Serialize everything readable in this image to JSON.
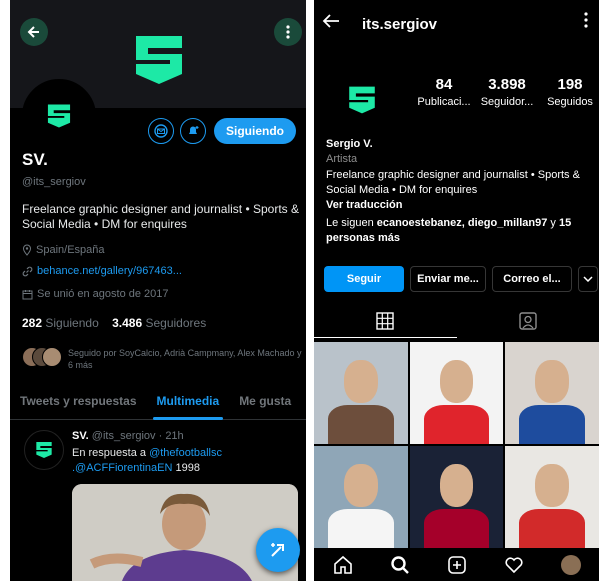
{
  "twitter": {
    "display_name": "SV.",
    "handle": "@its_sergiov",
    "follow_button": "Siguiendo",
    "bio": "Freelance graphic designer and journalist • Sports & Social Media • DM for enquires",
    "location": "Spain/España",
    "link": "behance.net/gallery/967463...",
    "joined": "Se unió en agosto de 2017",
    "following_count": "282",
    "following_label": "Siguiendo",
    "followers_count": "3.486",
    "followers_label": "Seguidores",
    "followed_by": "Seguido por SoyCalcio, Adrià Campmany, Alex Machado y 6 más",
    "tabs": [
      {
        "label": "Tweets y respuestas",
        "active": false
      },
      {
        "label": "Multimedia",
        "active": true
      },
      {
        "label": "Me gusta",
        "active": false
      }
    ],
    "tweet": {
      "name": "SV.",
      "handle_time": "@its_sergiov · 21h",
      "reply_prefix": "En respuesta a ",
      "reply_to_1": "@thefootballsc",
      "reply_to_2": ".@ACFFiorentinaEN",
      "text_suffix": " 1998"
    },
    "icons": {
      "back": "arrow-left-icon",
      "more": "more-vertical-icon",
      "message": "mail-icon",
      "notify": "bell-plus-icon",
      "location": "location-pin-icon",
      "link": "link-icon",
      "calendar": "calendar-icon",
      "compose": "compose-plus-icon"
    },
    "colors": {
      "accent": "#1d9bf0",
      "brand": "#1de9a6"
    }
  },
  "instagram": {
    "username": "its.sergiov",
    "stats": [
      {
        "number": "84",
        "label": "Publicaci..."
      },
      {
        "number": "3.898",
        "label": "Seguidor..."
      },
      {
        "number": "198",
        "label": "Seguidos"
      }
    ],
    "name": "Sergio V.",
    "category": "Artista",
    "bio": "Freelance graphic designer and journalist • Sports & Social Media • DM for enquires",
    "translation": "Ver traducción",
    "followed_prefix": "Le siguen ",
    "followed_names": "ecanoestebanez, diego_millan97",
    "followed_mid": " y ",
    "followed_more": "15 personas más",
    "buttons": {
      "follow": "Seguir",
      "message": "Enviar me...",
      "email": "Correo el...",
      "dropdown": "chevron-down-icon"
    },
    "grid_posts": [
      {
        "name": "post-1",
        "bg": "#b9c2ca",
        "shirt": "#6d4e3c"
      },
      {
        "name": "post-2",
        "bg": "#f3f3f3",
        "shirt": "#e0242c"
      },
      {
        "name": "post-3",
        "bg": "#d9d4cf",
        "shirt": "#1e4c9e"
      },
      {
        "name": "post-4",
        "bg": "#8fa6b7",
        "shirt": "#f5f5f5"
      },
      {
        "name": "post-5",
        "bg": "#1a2236",
        "shirt": "#a5002a"
      },
      {
        "name": "post-6",
        "bg": "#e9e7e3",
        "shirt": "#d22a2a"
      }
    ],
    "colors": {
      "accent": "#0095f6",
      "brand": "#1de9a6"
    }
  }
}
